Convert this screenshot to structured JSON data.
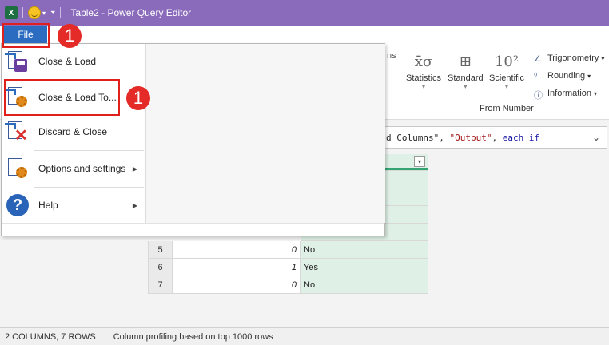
{
  "window": {
    "title": "Table2 - Power Query Editor",
    "app_icon": "excel-icon"
  },
  "ribbon": {
    "partial_label": "ns",
    "groups": [
      {
        "label": "Statistics",
        "symbol": "X̅σ\nΣ"
      },
      {
        "label": "Standard",
        "symbol": "⊞"
      },
      {
        "label": "Scientific",
        "symbol": "10²"
      }
    ],
    "small_commands": [
      "Trigonometry",
      "Rounding",
      "Information"
    ],
    "group_name": "From Number"
  },
  "formula": {
    "text_a": "d Columns\", ",
    "text_str": "\"Output\"",
    "text_b": ", ",
    "text_kw": "each if"
  },
  "file_menu": {
    "button_label": "File",
    "items": [
      {
        "label": "Close & Load",
        "icon": "close-load-icon"
      },
      {
        "label": "Close & Load To...",
        "icon": "close-load-to-icon"
      },
      {
        "label": "Discard & Close",
        "icon": "discard-close-icon"
      },
      {
        "label": "Options and settings",
        "icon": "options-icon"
      },
      {
        "label": "Help",
        "icon": "help-icon"
      }
    ]
  },
  "annotations": {
    "badge_1": "1",
    "badge_2": "1"
  },
  "grid": {
    "rows": [
      {
        "n": "5",
        "value": "0",
        "output": "No"
      },
      {
        "n": "6",
        "value": "1",
        "output": "Yes"
      },
      {
        "n": "7",
        "value": "0",
        "output": "No"
      }
    ]
  },
  "status": {
    "counts": "2 COLUMNS, 7 ROWS",
    "profiling": "Column profiling based on top 1000 rows"
  }
}
